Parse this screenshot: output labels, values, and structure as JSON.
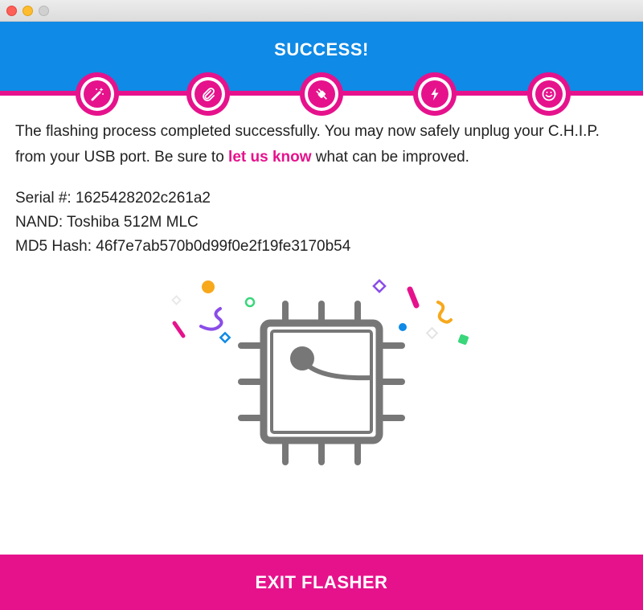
{
  "header": {
    "title": "SUCCESS!"
  },
  "steps": [
    {
      "icon": "magic-wand-icon"
    },
    {
      "icon": "paperclip-icon"
    },
    {
      "icon": "plug-icon"
    },
    {
      "icon": "lightning-icon"
    },
    {
      "icon": "smiley-icon"
    }
  ],
  "message": {
    "part1": "The flashing process completed successfully. You may now safely unplug your C.H.I.P. from your USB port.  Be sure to ",
    "link": "let us know",
    "part2": " what can be improved."
  },
  "info": {
    "serial": "Serial #: 1625428202c261a2",
    "nand": "NAND: Toshiba 512M MLC",
    "md5": "MD5 Hash: 46f7e7ab570b0d99f0e2f19fe3170b54"
  },
  "illustration": {
    "icon": "chip-icon"
  },
  "exit_button": {
    "label": "EXIT FLASHER"
  },
  "colors": {
    "header_blue": "#0f8ae6",
    "accent_pink": "#e6128c",
    "chip_gray": "#777777"
  }
}
